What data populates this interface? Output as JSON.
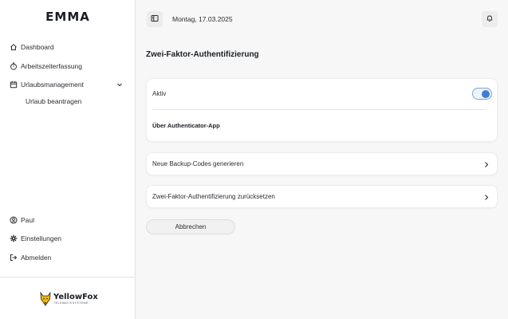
{
  "app": {
    "brand": "EMMA"
  },
  "sidebar": {
    "items": [
      {
        "label": "Dashboard",
        "icon": "home-icon"
      },
      {
        "label": "Arbeitszeiterfassung",
        "icon": "stopwatch-icon"
      },
      {
        "label": "Urlaubsmanagement",
        "icon": "calendar-icon",
        "expanded": true
      }
    ],
    "subitems": [
      {
        "label": "Urlaub beantragen"
      }
    ],
    "bottom_items": [
      {
        "label": "Paul",
        "icon": "user-icon"
      },
      {
        "label": "Einstellungen",
        "icon": "gear-icon"
      },
      {
        "label": "Abmelden",
        "icon": "logout-icon"
      }
    ],
    "logo": {
      "name": "YellowFox",
      "tagline": "TELEMATIKSYSTEME"
    }
  },
  "topbar": {
    "date": "Montag, 17.03.2025"
  },
  "main": {
    "title": "Zwei-Faktor-Authentifizierung",
    "active_label": "Aktiv",
    "active_on": true,
    "method_label": "Über Authenticator-App",
    "rows": [
      {
        "label": "Neue Backup-Codes generieren"
      },
      {
        "label": "Zwei-Faktor-Authentifizierung zurücksetzen"
      }
    ],
    "cancel_label": "Abbrechen"
  },
  "colors": {
    "accent": "#3e7fd6",
    "logo_yellow": "#f2b705"
  }
}
